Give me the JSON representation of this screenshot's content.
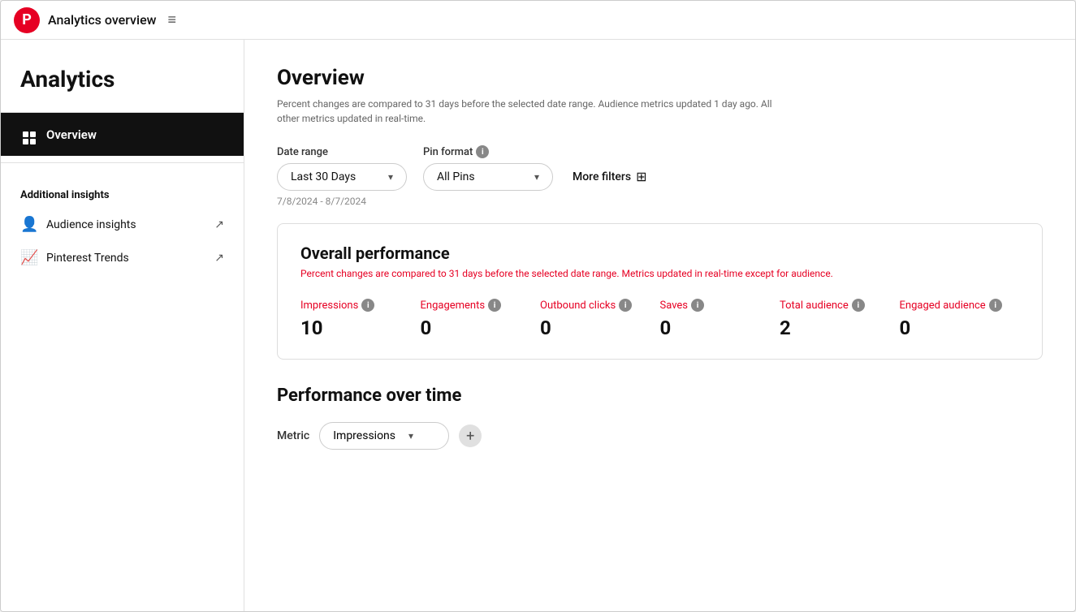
{
  "topbar": {
    "title": "Analytics overview",
    "hamburger": "≡"
  },
  "sidebar": {
    "analytics_title": "Analytics",
    "nav_items": [
      {
        "id": "overview",
        "label": "Overview",
        "active": true
      }
    ],
    "additional_insights_header": "Additional insights",
    "links": [
      {
        "id": "audience-insights",
        "label": "Audience insights",
        "icon": "👤"
      },
      {
        "id": "pinterest-trends",
        "label": "Pinterest Trends",
        "icon": "📈"
      }
    ]
  },
  "overview": {
    "title": "Overview",
    "subtitle": "Percent changes are compared to 31 days before the selected date range. Audience metrics updated 1 day ago. All other metrics updated in real-time.",
    "filters": {
      "date_range_label": "Date range",
      "date_range_value": "Last 30 Days",
      "pin_format_label": "Pin format",
      "pin_format_info": "i",
      "pin_format_value": "All Pins",
      "more_filters_label": "More filters",
      "date_range_display": "7/8/2024 - 8/7/2024"
    },
    "performance_card": {
      "title": "Overall performance",
      "subtitle": "Percent changes are compared to 31 days before the selected date range. Metrics updated in real-time except for audience.",
      "metrics": [
        {
          "id": "impressions",
          "label": "Impressions",
          "value": "10"
        },
        {
          "id": "engagements",
          "label": "Engagements",
          "value": "0"
        },
        {
          "id": "outbound-clicks",
          "label": "Outbound clicks",
          "value": "0"
        },
        {
          "id": "saves",
          "label": "Saves",
          "value": "0"
        },
        {
          "id": "total-audience",
          "label": "Total audience",
          "value": "2"
        },
        {
          "id": "engaged-audience",
          "label": "Engaged audience",
          "value": "0"
        }
      ]
    },
    "performance_over_time": {
      "title": "Performance over time",
      "metric_label": "Metric",
      "metric_value": "Impressions"
    }
  }
}
